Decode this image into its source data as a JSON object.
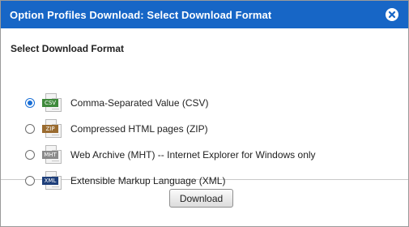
{
  "dialog": {
    "title": "Option Profiles Download: Select Download Format",
    "close_icon": "close-icon",
    "accent_color": "#1766c6"
  },
  "section": {
    "heading": "Select Download Format"
  },
  "options": [
    {
      "id": "csv",
      "tag": "CSV",
      "tag_color": "#3f8a3c",
      "label": "Comma-Separated Value (CSV)",
      "checked": true
    },
    {
      "id": "zip",
      "tag": "ZIP",
      "tag_color": "#9a6b2f",
      "label": "Compressed HTML pages (ZIP)",
      "checked": false
    },
    {
      "id": "mht",
      "tag": "MHT",
      "tag_color": "#8a8a8a",
      "label": "Web Archive (MHT) -- Internet Explorer for Windows only",
      "checked": false
    },
    {
      "id": "xml",
      "tag": "XML",
      "tag_color": "#1e3f7a",
      "label": "Extensible Markup Language (XML)",
      "checked": false
    }
  ],
  "footer": {
    "download_label": "Download"
  }
}
